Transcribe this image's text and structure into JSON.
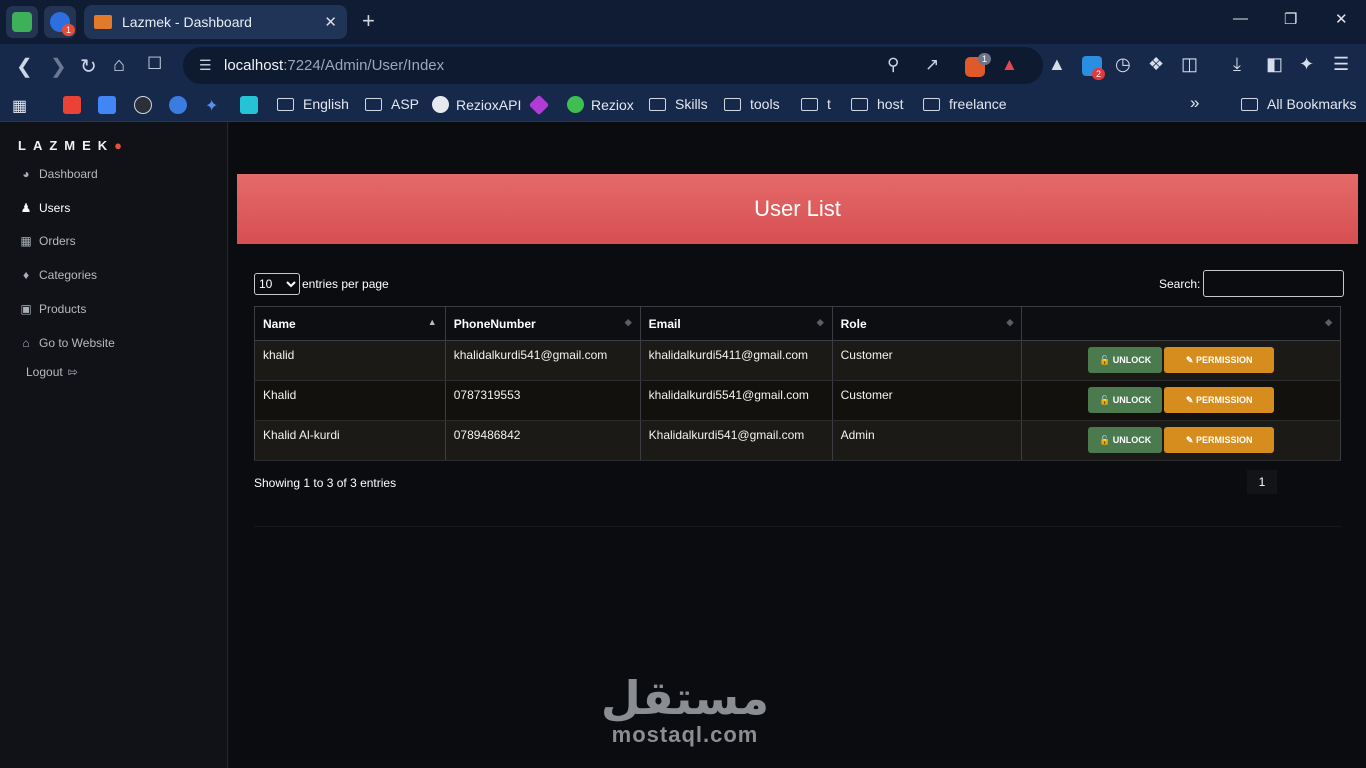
{
  "browser": {
    "tab_title": "Lazmek - Dashboard",
    "tab_close": "✕",
    "new_tab": "+",
    "pinned_badge": "1",
    "url_host": "localhost",
    "url_path": ":7224/Admin/User/Index",
    "brave_badge": "1",
    "ext_badge": "2",
    "window_controls": {
      "minimize": "—",
      "maximize": "❐",
      "close": "✕"
    }
  },
  "bookmarks": {
    "items": [
      {
        "label": "English",
        "icon": "folder-icon"
      },
      {
        "label": "ASP",
        "icon": "folder-icon"
      },
      {
        "label": "RezioxAPI",
        "icon": "github-icon"
      },
      {
        "label": "Reziox",
        "icon": "globe-icon"
      },
      {
        "label": "Skills",
        "icon": "folder-icon"
      },
      {
        "label": "tools",
        "icon": "folder-icon"
      },
      {
        "label": "t",
        "icon": "folder-icon"
      },
      {
        "label": "host",
        "icon": "folder-icon"
      },
      {
        "label": "freelance",
        "icon": "folder-icon"
      }
    ],
    "overflow": "»",
    "all_bookmarks": "All Bookmarks"
  },
  "sidebar": {
    "logo": "LAZMEK",
    "items": [
      {
        "label": "Dashboard",
        "icon": "gauge-icon",
        "active": false
      },
      {
        "label": "Users",
        "icon": "users-icon",
        "active": true
      },
      {
        "label": "Orders",
        "icon": "table-icon",
        "active": false
      },
      {
        "label": "Categories",
        "icon": "tags-icon",
        "active": false
      },
      {
        "label": "Products",
        "icon": "box-icon",
        "active": false
      },
      {
        "label": "Go to Website",
        "icon": "home-icon",
        "active": false
      }
    ],
    "logout": "Logout"
  },
  "page": {
    "title": "User List",
    "length_value": "10",
    "length_suffix": "entries per page",
    "search_label": "Search:",
    "columns": [
      "Name",
      "PhoneNumber",
      "Email",
      "Role",
      ""
    ],
    "rows": [
      {
        "name": "khalid",
        "phone": "khalidalkurdi541@gmail.com",
        "email": "khalidalkurdi5411@gmail.com",
        "role": "Customer"
      },
      {
        "name": "Khalid",
        "phone": "0787319553",
        "email": "khalidalkurdi5541@gmail.com",
        "role": "Customer"
      },
      {
        "name": "Khalid Al-kurdi",
        "phone": "0789486842",
        "email": "Khalidalkurdi541@gmail.com",
        "role": "Admin"
      }
    ],
    "unlock_label": "UNLOCK",
    "permission_label": "PERMISSION",
    "info": "Showing 1 to 3 of 3 entries",
    "current_page": "1"
  },
  "watermark": {
    "arabic": "مستقل",
    "latin": "mostaql.com"
  },
  "colors": {
    "banner": "#d64f52",
    "unlock": "#4c7a4f",
    "permission": "#d78c1e",
    "sidebar_bg": "#111217",
    "browser_frame": "#16294a"
  }
}
